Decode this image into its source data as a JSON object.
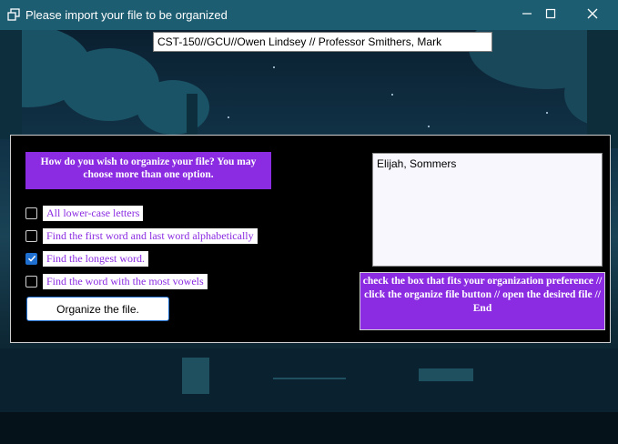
{
  "window": {
    "title": "Please import your file to be organized"
  },
  "header_field": {
    "value": "CST-150//GCU//Owen Lindsey // Professor Smithers, Mark"
  },
  "form": {
    "question": "How do you wish to organize your file? You may choose more than one option.",
    "options": [
      {
        "label": "All lower-case letters",
        "checked": false
      },
      {
        "label": "Find the first word and last word alphabetically",
        "checked": false
      },
      {
        "label": "Find the longest word.",
        "checked": true
      },
      {
        "label": "Find the word with the most vowels",
        "checked": false
      }
    ],
    "organize_button": "Organize the file."
  },
  "output": {
    "text": "Elijah, Sommers"
  },
  "instructions": "check the box that fits your organization preference // click the organize file button // open the desired file // End",
  "colors": {
    "titlebar": "#1d5d72",
    "accent_purple": "#8b2be2",
    "checkbox_checked": "#1e6fd0",
    "panel": "#000000"
  }
}
